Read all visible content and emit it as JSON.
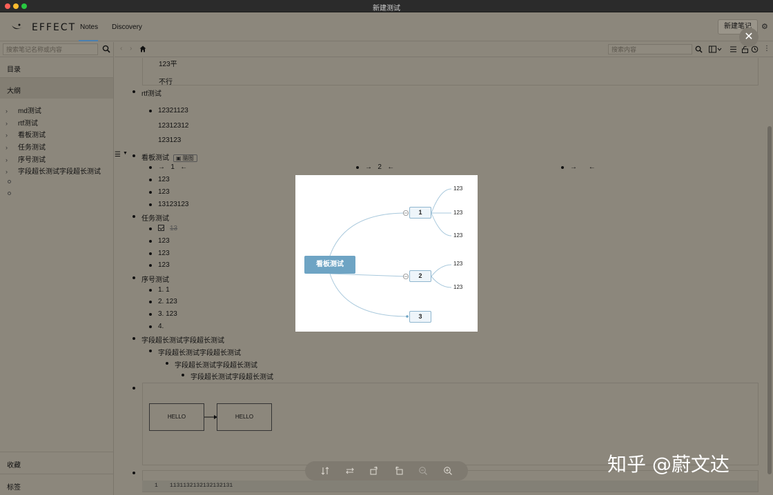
{
  "window": {
    "title": "新建测试"
  },
  "header": {
    "logo_text": "EFFECT",
    "tabs": [
      {
        "label": "Notes",
        "active": true
      },
      {
        "label": "Discovery",
        "active": false
      }
    ],
    "new_note_label": "新建笔记"
  },
  "sidebar": {
    "search_placeholder": "搜索笔记名称或内容",
    "toc_label": "目录",
    "outline_label": "大纲",
    "outline_items": [
      "md测试",
      "rtf测试",
      "看板测试",
      "任务测试",
      "序号测试",
      "字段超长测试字段超长测试"
    ],
    "favorites_label": "收藏",
    "tags_label": "标签"
  },
  "toolbar": {
    "search_placeholder": "搜索内容"
  },
  "editor": {
    "top_lines": [
      "123平",
      "不行"
    ],
    "rtf_title": "rtf测试",
    "rtf_lines": [
      "12321123",
      "12312312",
      "123123"
    ],
    "kanban_title": "看板测试",
    "mindmap_chip": "脑图",
    "kanban_columns": [
      "1",
      "2",
      ""
    ],
    "kanban_items": [
      "123",
      "123",
      "13123123"
    ],
    "task_title": "任务测试",
    "task_items": [
      "13",
      "123",
      "123",
      "123"
    ],
    "order_title": "序号测试",
    "order_items": [
      "1. 1",
      "2. 123",
      "3. 123",
      "4."
    ],
    "long_items": [
      "字段超长测试字段超长测试",
      "字段超长测试字段超长测试",
      "字段超长测试字段超长测试",
      "字段超长测试字段超长测试"
    ],
    "flow_nodes": [
      "HELLO",
      "HELLO"
    ],
    "code_line_number": "1",
    "code_text": "1131132132132132131"
  },
  "mindmap": {
    "root": "看板测试",
    "nodes": [
      {
        "label": "1",
        "leaves": [
          "123",
          "123",
          "123"
        ]
      },
      {
        "label": "2",
        "leaves": [
          "123",
          "123"
        ]
      },
      {
        "label": "3",
        "leaves": []
      }
    ]
  },
  "watermark": "知乎 @蔚文达"
}
